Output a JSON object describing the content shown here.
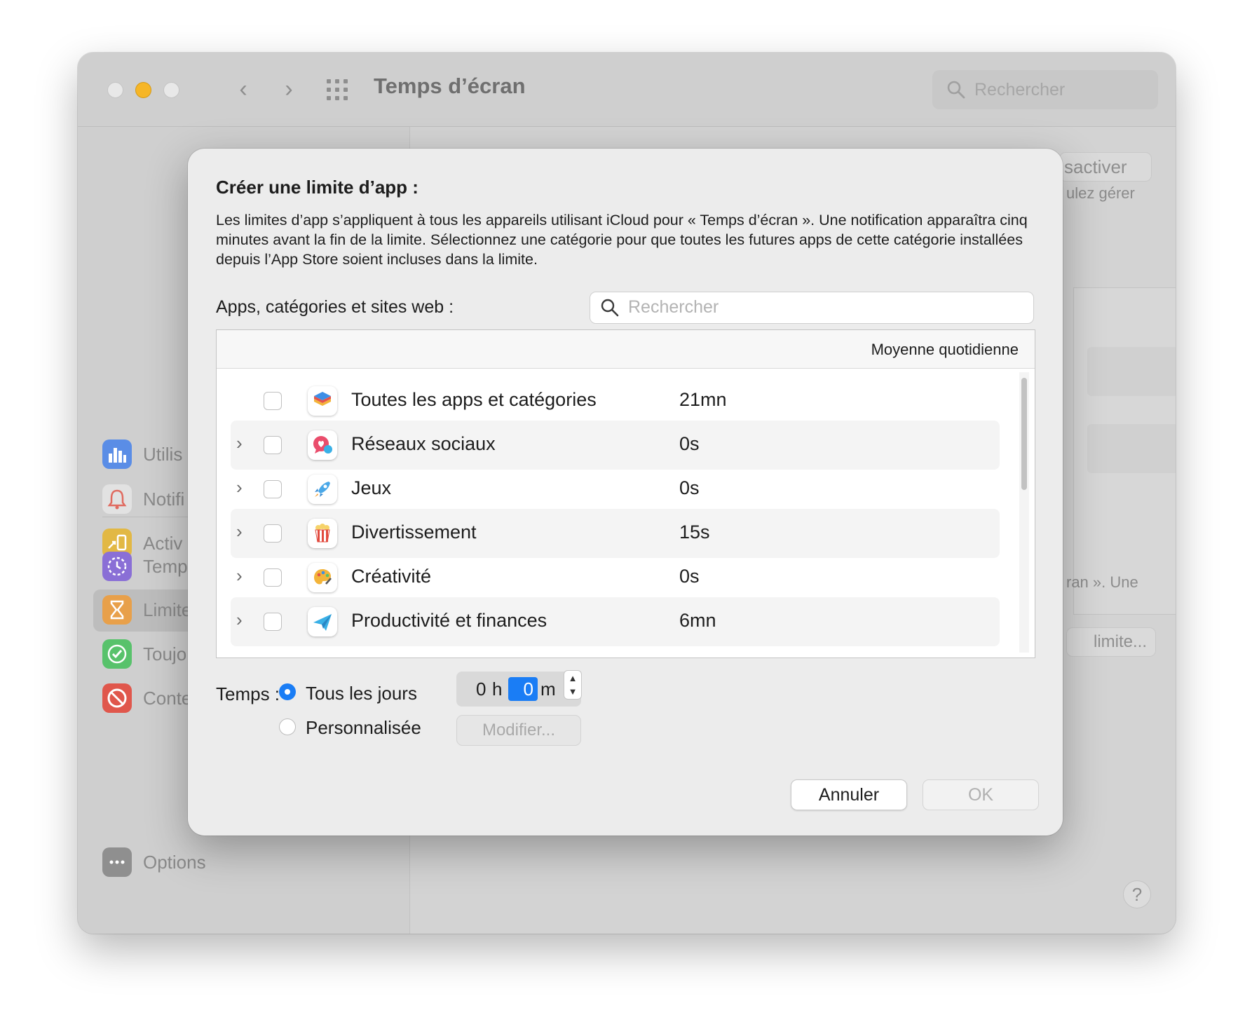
{
  "window": {
    "title": "Temps d’écran",
    "search_placeholder": "Rechercher"
  },
  "sidebar": {
    "items": [
      {
        "label": "Utilis",
        "icon": "bar-chart-icon",
        "color": "#5a8de6"
      },
      {
        "label": "Notifi",
        "icon": "bell-icon",
        "color": "#e06a5f"
      },
      {
        "label": "Activ",
        "icon": "pickup-icon",
        "color": "#e2b844"
      },
      {
        "label": "Temp",
        "icon": "downtime-icon",
        "color": "#8a6fd6"
      },
      {
        "label": "Limite",
        "icon": "hourglass-icon",
        "color": "#e8a04a"
      },
      {
        "label": "Toujo",
        "icon": "checkmark-icon",
        "color": "#58c26b"
      },
      {
        "label": "Conte",
        "icon": "restriction-icon",
        "color": "#e0574c"
      }
    ],
    "options_label": "Options"
  },
  "background": {
    "deactivate_button": "sactiver",
    "manage_text": "ulez gérer",
    "notice_text": "ran ». Une",
    "limit_button": "limite...",
    "help": "?"
  },
  "dialog": {
    "title": "Créer une limite d’app :",
    "description": "Les limites d’app s’appliquent à tous les appareils utilisant iCloud pour « Temps d’écran ». Une notification apparaîtra cinq minutes avant la fin de la limite. Sélectionnez une catégorie pour que toutes les futures apps de cette catégorie installées depuis l’App Store soient incluses dans la limite.",
    "list_label": "Apps, catégories et sites web :",
    "search_placeholder": "Rechercher",
    "column_header": "Moyenne quotidienne",
    "rows": [
      {
        "name": "Toutes les apps et catégories",
        "average": "21mn",
        "expandable": false,
        "icon": "stack-icon"
      },
      {
        "name": "Réseaux sociaux",
        "average": "0s",
        "expandable": true,
        "icon": "social-bubble-icon"
      },
      {
        "name": "Jeux",
        "average": "0s",
        "expandable": true,
        "icon": "rocket-icon"
      },
      {
        "name": "Divertissement",
        "average": "15s",
        "expandable": true,
        "icon": "popcorn-icon"
      },
      {
        "name": "Créativité",
        "average": "0s",
        "expandable": true,
        "icon": "palette-icon"
      },
      {
        "name": "Productivité et finances",
        "average": "6mn",
        "expandable": true,
        "icon": "paper-plane-icon"
      }
    ],
    "time_label": "Temps :",
    "radio_every_day": "Tous les jours",
    "radio_custom": "Personnalisée",
    "hours_value": "0",
    "hours_unit": "h",
    "minutes_value": "0",
    "minutes_unit": "m",
    "modify_button": "Modifier...",
    "cancel_button": "Annuler",
    "ok_button": "OK",
    "accent_color": "#1a7df5"
  }
}
